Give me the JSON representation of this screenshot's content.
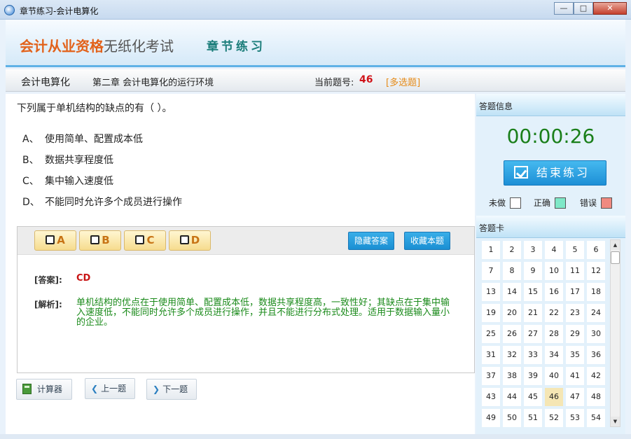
{
  "window": {
    "title": "章节练习-会计电算化",
    "minimize": "—",
    "maximize": "□",
    "close": "✕"
  },
  "header": {
    "brand_highlight": "会计从业资格",
    "brand_rest": "无纸化考试",
    "section": "章节练习"
  },
  "subheader": {
    "subject": "会计电算化",
    "chapter": "第二章 会计电算化的运行环境",
    "question_label": "当前题号:",
    "question_number": "46",
    "question_type": "[多选题]"
  },
  "question": {
    "text": "下列属于单机结构的缺点的有（ ）。",
    "options": [
      {
        "letter": "A、",
        "text": "使用简单、配置成本低"
      },
      {
        "letter": "B、",
        "text": "数据共享程度低"
      },
      {
        "letter": "C、",
        "text": "集中输入速度低"
      },
      {
        "letter": "D、",
        "text": "不能同时允许多个成员进行操作"
      }
    ]
  },
  "answer_panel": {
    "choices": [
      "A",
      "B",
      "C",
      "D"
    ],
    "hide_answer": "隐藏答案",
    "bookmark": "收藏本题",
    "answer_label": "[答案]:",
    "answer_value": "CD",
    "analysis_label": "[解析]:",
    "analysis_text": "单机结构的优点在于使用简单、配置成本低，数据共享程度高，一致性好；其缺点在于集中输入速度低，不能同时允许多个成员进行操作，并且不能进行分布式处理。适用于数据输入量小的企业。"
  },
  "nav": {
    "calculator": "计算器",
    "prev": "上一题",
    "next": "下一题"
  },
  "side": {
    "info_title": "答题信息",
    "timer": "00:00:26",
    "finish": "结束练习",
    "legend": [
      {
        "label": "未做",
        "color": "#ffffff"
      },
      {
        "label": "正确",
        "color": "#7fe8c8"
      },
      {
        "label": "错误",
        "color": "#f08a80"
      }
    ],
    "card_title": "答题卡",
    "current": 46,
    "numbers": [
      1,
      2,
      3,
      4,
      5,
      6,
      7,
      8,
      9,
      10,
      11,
      12,
      13,
      14,
      15,
      16,
      17,
      18,
      19,
      20,
      21,
      22,
      23,
      24,
      25,
      26,
      27,
      28,
      29,
      30,
      31,
      32,
      33,
      34,
      35,
      36,
      37,
      38,
      39,
      40,
      41,
      42,
      43,
      44,
      45,
      46,
      47,
      48,
      49,
      50,
      51,
      52,
      53,
      54
    ]
  }
}
